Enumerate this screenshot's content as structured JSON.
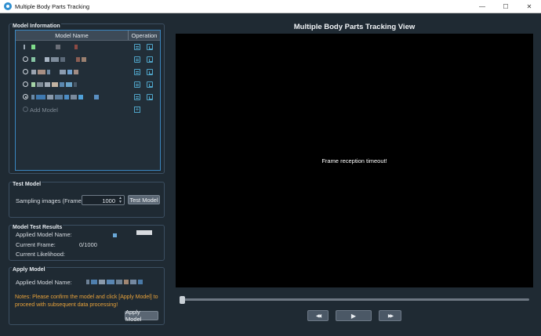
{
  "window": {
    "title": "Multiple Body Parts Tracking",
    "minimize_glyph": "—",
    "maximize_glyph": "☐",
    "close_glyph": "✕"
  },
  "model_info": {
    "title": "Model Information",
    "col_name": "Model Name",
    "col_operation": "Operation",
    "add_model_label": "Add Model",
    "add_glyph": "+"
  },
  "test_model": {
    "title": "Test Model",
    "sampling_label": "Sampling images (Frames)",
    "sampling_value": "1000",
    "spin_up": "▲",
    "spin_down": "▼",
    "button_label": "Test Model"
  },
  "test_results": {
    "title": "Model Test Results",
    "applied_label": "Applied Model Name:",
    "frame_label": "Current Frame:",
    "frame_value": "0/1000",
    "likelihood_label": "Current Likelihood:"
  },
  "apply_model": {
    "title": "Apply Model",
    "applied_label": "Applied Model Name:",
    "notes": "Notes: Please confirm the model and click [Apply Model] to proceed with subsequent data processing!",
    "button_label": "Apply Model"
  },
  "view": {
    "title": "Multiple Body Parts Tracking View",
    "message": "Frame reception timeout!",
    "rewind_glyph": "◀◀",
    "play_glyph": "▶",
    "forward_glyph": "▶▶"
  },
  "colors": {
    "accent": "#3a86c0",
    "warning": "#e8a23a",
    "background": "#1f2a33"
  }
}
